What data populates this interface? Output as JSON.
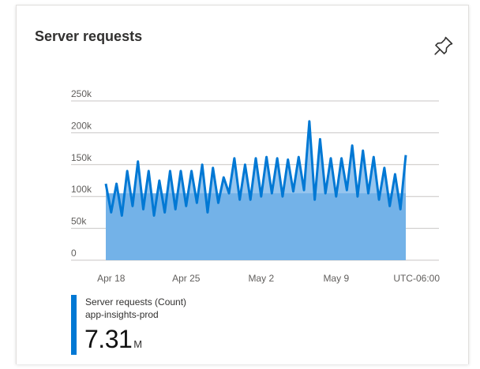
{
  "tile": {
    "title": "Server requests",
    "pin_icon": "pin-icon"
  },
  "legend": {
    "series_label": "Server requests (Count)",
    "resource_label": "app-insights-prod",
    "total_value": "7.31",
    "total_unit": "M",
    "color": "#0078d4"
  },
  "colors": {
    "line": "#0078d4",
    "area": "#73b2e8",
    "grid": "#c8c6c4",
    "tick_text": "#605e5c"
  },
  "chart_data": {
    "type": "area",
    "title": "Server requests",
    "xlabel": "",
    "ylabel": "",
    "timezone_label": "UTC-06:00",
    "ylim": [
      0,
      250000
    ],
    "y_ticks": [
      0,
      50000,
      100000,
      150000,
      200000,
      250000
    ],
    "y_tick_labels": [
      "0",
      "50k",
      "100k",
      "150k",
      "200k",
      "250k"
    ],
    "x_range": [
      "Apr 17 12:00",
      "May 15 12:00"
    ],
    "x_ticks": [
      "Apr 18",
      "Apr 25",
      "May 2",
      "May 9"
    ],
    "grid": true,
    "legend_position": "bottom-left",
    "series": [
      {
        "name": "Server requests (Count)",
        "baseline_value": 105000,
        "x": [
          "Apr 17 12:00",
          "Apr 18 00:00",
          "Apr 18 12:00",
          "Apr 19 00:00",
          "Apr 19 12:00",
          "Apr 20 00:00",
          "Apr 20 12:00",
          "Apr 21 00:00",
          "Apr 21 12:00",
          "Apr 22 00:00",
          "Apr 22 12:00",
          "Apr 23 00:00",
          "Apr 23 12:00",
          "Apr 24 00:00",
          "Apr 24 12:00",
          "Apr 25 00:00",
          "Apr 25 12:00",
          "Apr 26 00:00",
          "Apr 26 12:00",
          "Apr 27 00:00",
          "Apr 27 12:00",
          "Apr 28 00:00",
          "Apr 28 12:00",
          "Apr 29 00:00",
          "Apr 29 12:00",
          "Apr 30 00:00",
          "Apr 30 12:00",
          "May 1 00:00",
          "May 1 12:00",
          "May 2 00:00",
          "May 2 12:00",
          "May 3 00:00",
          "May 3 12:00",
          "May 4 00:00",
          "May 4 12:00",
          "May 5 00:00",
          "May 5 12:00",
          "May 6 00:00",
          "May 6 12:00",
          "May 7 00:00",
          "May 7 12:00",
          "May 8 00:00",
          "May 8 12:00",
          "May 9 00:00",
          "May 9 12:00",
          "May 10 00:00",
          "May 10 12:00",
          "May 11 00:00",
          "May 11 12:00",
          "May 12 00:00",
          "May 12 12:00",
          "May 13 00:00",
          "May 13 12:00",
          "May 14 00:00",
          "May 14 12:00",
          "May 15 00:00",
          "May 15 12:00"
        ],
        "values": [
          120000,
          75000,
          120000,
          70000,
          140000,
          85000,
          155000,
          80000,
          140000,
          70000,
          125000,
          75000,
          140000,
          80000,
          140000,
          85000,
          140000,
          90000,
          150000,
          75000,
          145000,
          90000,
          130000,
          105000,
          160000,
          95000,
          150000,
          95000,
          160000,
          100000,
          162000,
          105000,
          160000,
          100000,
          158000,
          108000,
          162000,
          110000,
          218000,
          95000,
          190000,
          105000,
          160000,
          100000,
          160000,
          110000,
          180000,
          100000,
          172000,
          105000,
          162000,
          95000,
          145000,
          85000,
          135000,
          80000,
          165000
        ]
      }
    ]
  }
}
